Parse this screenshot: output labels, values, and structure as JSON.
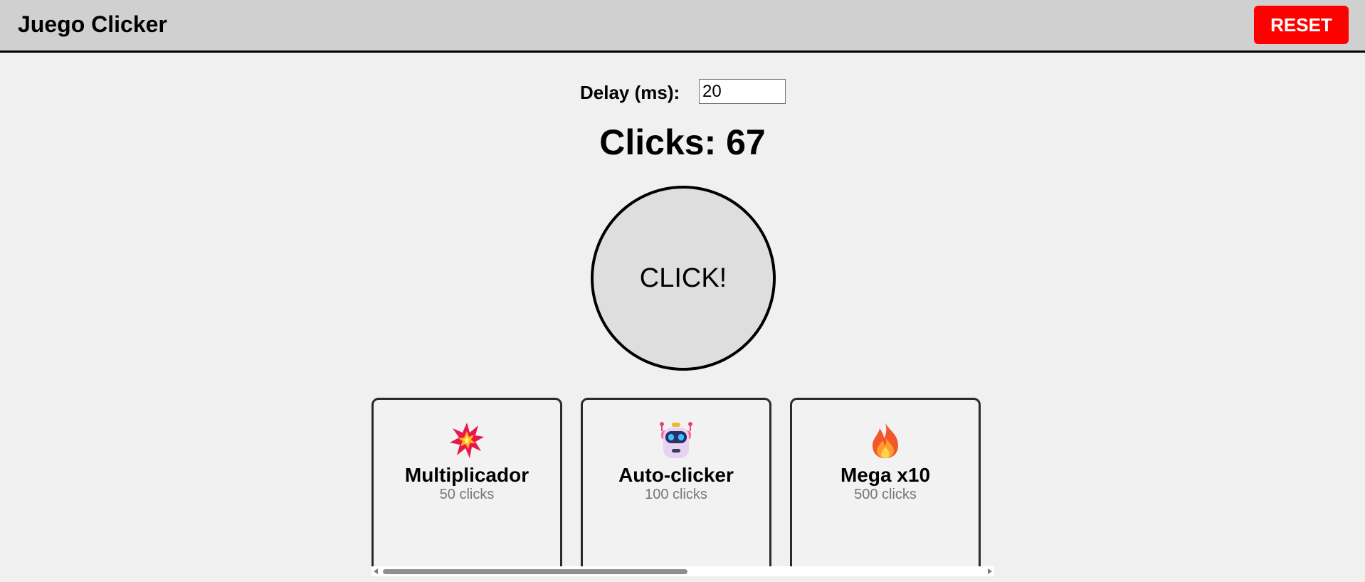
{
  "header": {
    "title": "Juego Clicker",
    "reset_label": "RESET"
  },
  "delay": {
    "label": "Delay (ms):",
    "value": "20"
  },
  "counter": {
    "text": "Clicks: 67"
  },
  "click_button": {
    "label": "CLICK!"
  },
  "shop": {
    "items": [
      {
        "icon": "explosion-icon",
        "name": "Multiplicador",
        "price": "50 clicks"
      },
      {
        "icon": "robot-icon",
        "name": "Auto-clicker",
        "price": "100 clicks"
      },
      {
        "icon": "fire-icon",
        "name": "Mega x10",
        "price": "500 clicks"
      }
    ]
  },
  "colors": {
    "reset": "#ff0000",
    "header_bg": "#d0d0d0",
    "page_bg": "#f0f0f0"
  }
}
